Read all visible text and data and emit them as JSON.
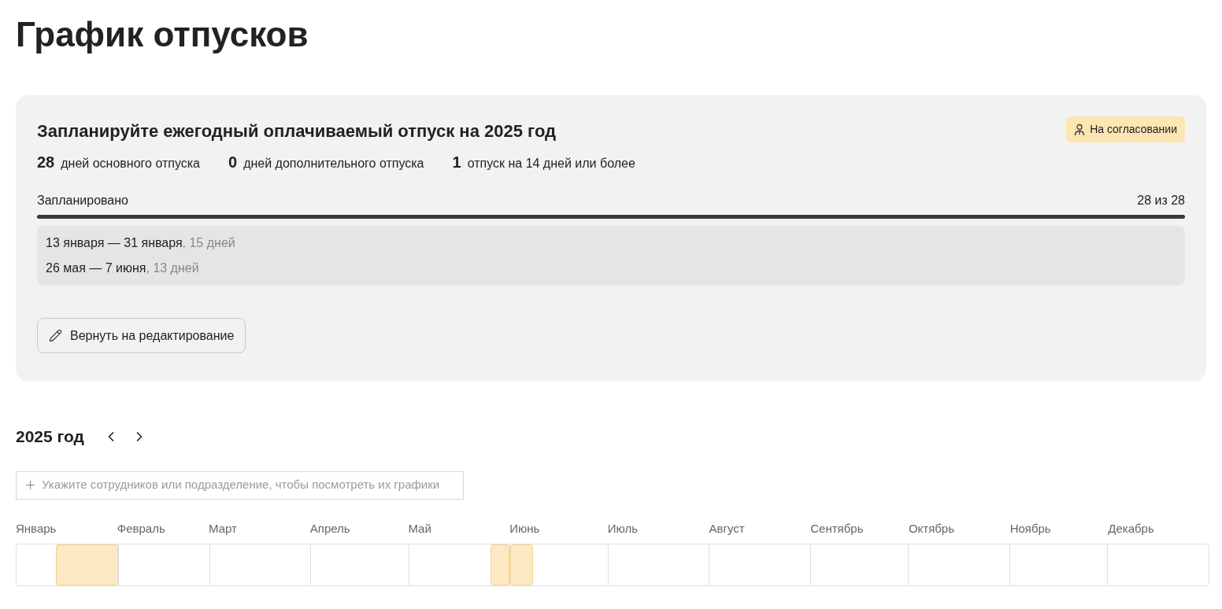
{
  "page_title": "График отпусков",
  "plan_card": {
    "title": "Запланируйте ежегодный оплачиваемый отпуск на 2025 год",
    "status": "На согласовании",
    "stats": [
      {
        "value": "28",
        "label": "дней основного отпуска"
      },
      {
        "value": "0",
        "label": "дней дополнительного отпуска"
      },
      {
        "value": "1",
        "label": "отпуск на 14 дней или более"
      }
    ],
    "progress": {
      "label": "Запланировано",
      "reading": "28 из 28",
      "level": 1
    },
    "periods": [
      {
        "dates": "13 января — 31 января",
        "days": ", 15 дней"
      },
      {
        "dates": "26 мая — 7 июня",
        "days": ", 13 дней"
      }
    ],
    "action_button": "Вернуть на редактирование"
  },
  "calendar": {
    "year": "2025 год",
    "search": {
      "placeholder": "Укажите сотрудников или подразделение, чтобы посмотреть их графики"
    },
    "months": [
      {
        "name": "Январь",
        "vacation": {
          "kind": "month_end",
          "level": 0.6129
        }
      },
      {
        "name": "Февраль"
      },
      {
        "name": "Март"
      },
      {
        "name": "Апрель"
      },
      {
        "name": "Май",
        "vacation": {
          "kind": "month_end",
          "level": 0.1935
        }
      },
      {
        "name": "Июнь",
        "vacation": {
          "kind": "month_start",
          "level": 0.2333
        }
      },
      {
        "name": "Июль"
      },
      {
        "name": "Август"
      },
      {
        "name": "Сентябрь"
      },
      {
        "name": "Октябрь"
      },
      {
        "name": "Ноябрь"
      },
      {
        "name": "Декабрь"
      }
    ]
  }
}
